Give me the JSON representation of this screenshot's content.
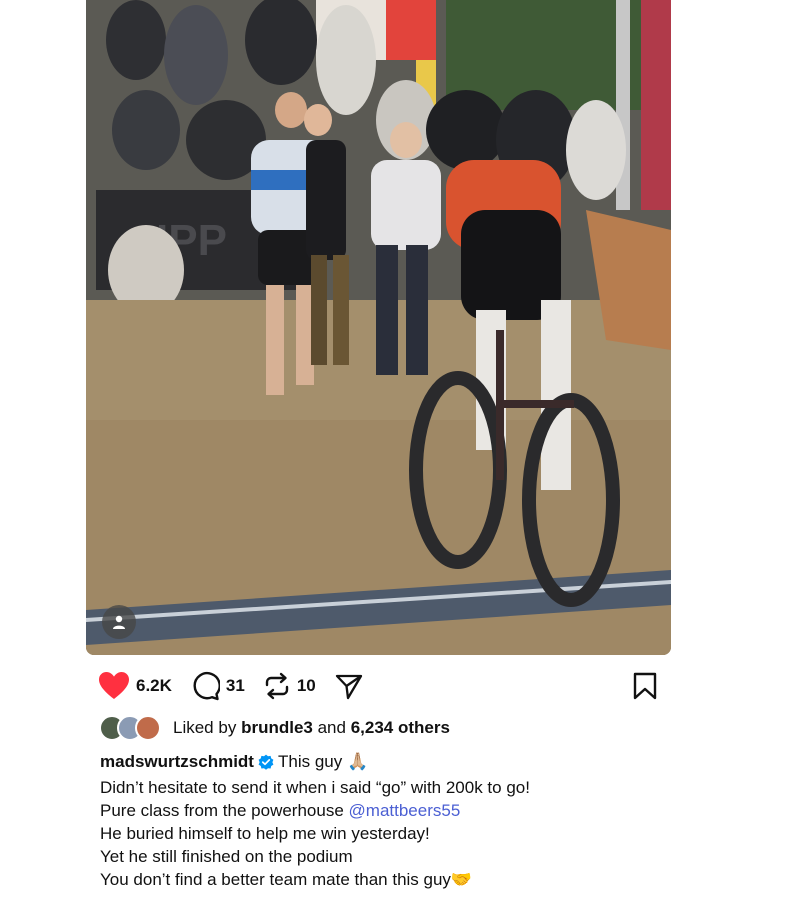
{
  "post": {
    "actions": {
      "likes_count": "6.2K",
      "comments_count": "31",
      "reposts_count": "10"
    },
    "liked_by": {
      "prefix": "Liked by",
      "user": "brundle3",
      "middle": "and",
      "others": "6,234 others"
    },
    "caption": {
      "username": "madswurtzschmidt",
      "first_line_text": "This guy 🙏🏼",
      "lines": [
        "Didn’t hesitate to send it when i said “go” with 200k to go!",
        "He buried himself to help me win yesterday!",
        "Yet he still finished on the podium",
        "You don’t find a better team mate than this guy🤝"
      ],
      "line3_prefix": "Pure class from the powerhouse",
      "mention": "@mattbeers55"
    },
    "colors": {
      "like_red": "#ff3040",
      "mention_blue": "#4b5fd3",
      "verified_blue": "#0095f6"
    }
  }
}
